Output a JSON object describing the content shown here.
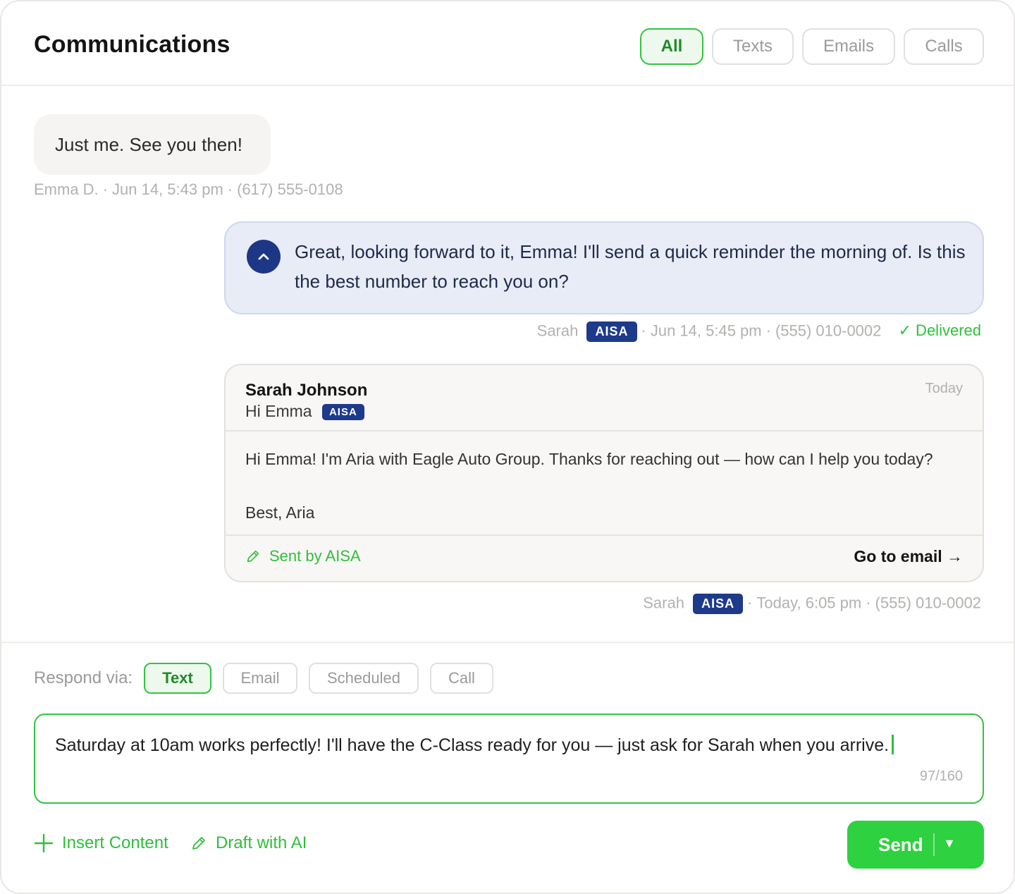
{
  "header": {
    "title": "Communications",
    "filters": [
      {
        "label": "All",
        "active": true
      },
      {
        "label": "Texts",
        "active": false
      },
      {
        "label": "Emails",
        "active": false
      },
      {
        "label": "Calls",
        "active": false
      }
    ]
  },
  "messages": {
    "incoming": {
      "text": "Just me. See you then!",
      "sender": "Emma D.",
      "time": "Jun 14, 5:43 pm",
      "phone": "(617) 555-0108"
    },
    "outgoing": {
      "text": "Great, looking forward to it, Emma! I'll send a quick reminder the morning of. Is this the best number to reach you on?",
      "sender": "Sarah",
      "badge": "AISA",
      "time": "Jun 14, 5:45 pm",
      "phone": "(555) 010-0002",
      "status": "✓ Delivered"
    },
    "email": {
      "sender": "Sarah Johnson",
      "subject": "Hi Emma",
      "badge": "AISA",
      "date": "Today",
      "body_line1": "Hi Emma! I'm Aria with Eagle Auto Group. Thanks for reaching out — how can I help you today?",
      "body_line2": "Best, Aria",
      "sent_by": "Sent by AISA",
      "go_to": "Go to email →",
      "meta_sender": "Sarah",
      "meta_badge": "AISA",
      "meta_time": "Today, 6:05 pm",
      "meta_phone": "(555) 010-0002"
    }
  },
  "composer": {
    "respond_label": "Respond via:",
    "channels": [
      {
        "label": "Text",
        "active": true
      },
      {
        "label": "Email",
        "active": false
      },
      {
        "label": "Scheduled",
        "active": false
      },
      {
        "label": "Call",
        "active": false
      }
    ],
    "value": "Saturday at 10am works perfectly! I'll have the C-Class ready for you — just ask for Sarah when you arrive.",
    "counter": "97/160",
    "insert_label": "Insert Content",
    "draft_label": "Draft with AI",
    "send_label": "Send",
    "send_caret": "▼"
  },
  "colors": {
    "accent_green": "#2ed13f",
    "navy": "#1e3a8a",
    "outgoing_bubble": "#e8ecf7"
  },
  "icons": [
    "chevron-up-icon",
    "pencil-icon",
    "plus-icon",
    "arrow-right-icon",
    "caret-down-icon"
  ]
}
